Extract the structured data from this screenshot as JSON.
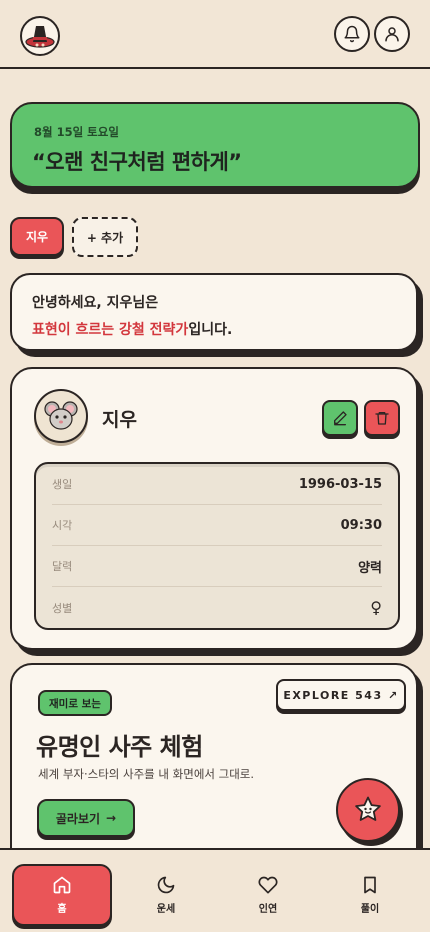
{
  "header": {
    "logo_icon": "fortune-hat-logo",
    "notification_icon": "bell-icon",
    "profile_icon": "user-icon"
  },
  "banner": {
    "date": "8월 15일 토요일",
    "quote": "“오랜 친구처럼 편하게”"
  },
  "profiles": {
    "active": "지우",
    "add_label": "+ 추가"
  },
  "greeting": {
    "line1": "안녕하세요, 지우님은",
    "highlight": "표현이 흐르는 강철 전략가",
    "suffix": "입니다."
  },
  "profile_card": {
    "avatar_icon": "mouse-icon",
    "name": "지우",
    "rows": [
      {
        "label": "생일",
        "value": "1996-03-15"
      },
      {
        "label": "시각",
        "value": "09:30"
      },
      {
        "label": "달력",
        "value": "양력"
      },
      {
        "label": "성별",
        "value": "♀"
      }
    ]
  },
  "celeb_card": {
    "tag": "재미로 보는",
    "explore": "EXPLORE 543 ↗",
    "title": "유명인 사주 체험",
    "subtitle": "세계 부자·스타의 사주를 내 화면에서 그대로.",
    "browse": "골라보기",
    "browse_arrow": "→"
  },
  "nav": {
    "items": [
      {
        "label": "홈",
        "icon": "home-icon"
      },
      {
        "label": "운세",
        "icon": "moon-icon"
      },
      {
        "label": "인연",
        "icon": "heart-icon"
      },
      {
        "label": "풀이",
        "icon": "bookmark-icon"
      }
    ]
  },
  "colors": {
    "background": "#f2e6d6",
    "green": "#5fc36d",
    "red": "#ea5558",
    "ink": "#2b2523",
    "highlight_text": "#d3373d"
  }
}
